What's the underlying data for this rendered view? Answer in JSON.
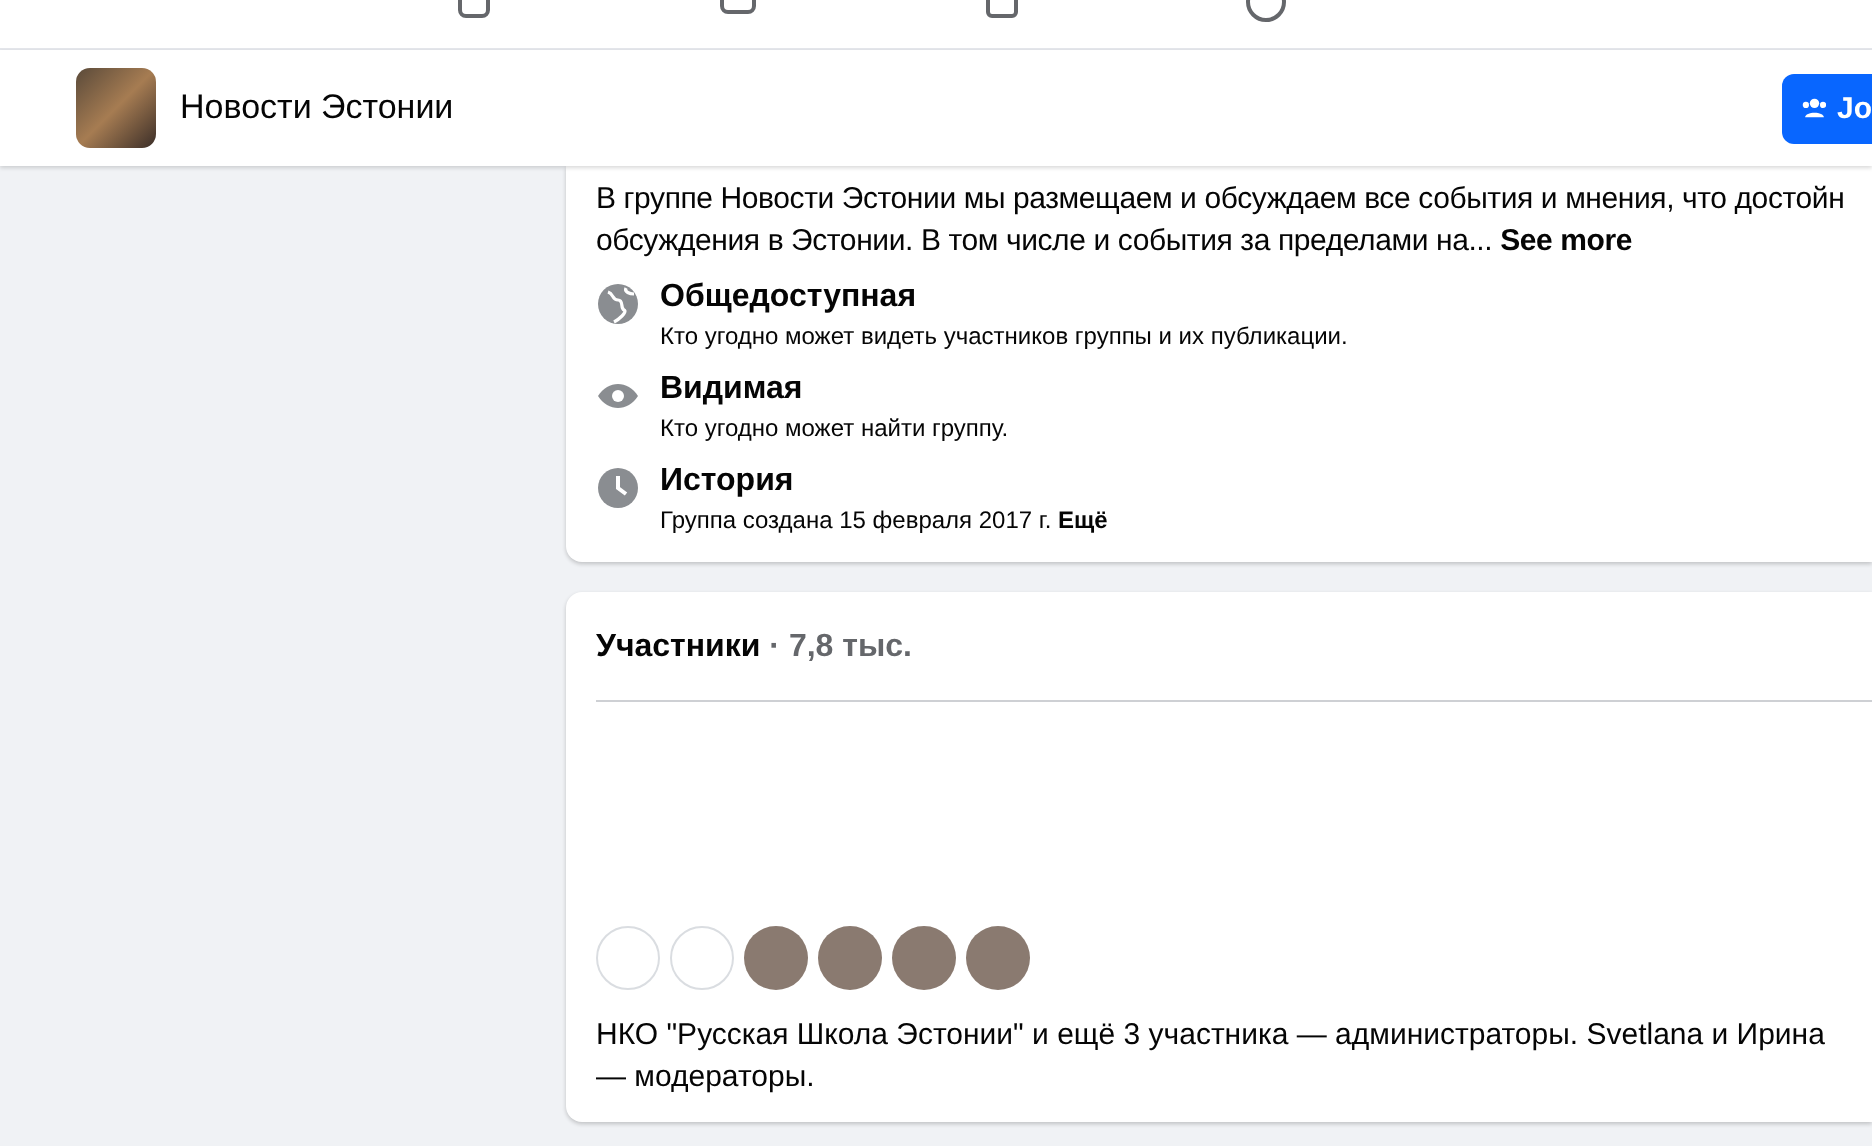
{
  "top_nav": {
    "items": [
      {
        "kind": "grid"
      },
      {
        "kind": "screen"
      },
      {
        "kind": "store"
      },
      {
        "kind": "people"
      }
    ]
  },
  "group_header": {
    "title": "Новости Эстонии",
    "join_button": "Jo"
  },
  "about": {
    "description_lines": [
      "В группе Новости Эстонии мы размещаем и обсуждаем все события и мнения, что достойн",
      "обсуждения в Эстонии. В том числе и события за пределами на..."
    ],
    "see_more": "See more",
    "facts": [
      {
        "kind": "globe",
        "title": "Общедоступная",
        "text": "Кто угодно может видеть участников группы и их публикации."
      },
      {
        "kind": "eye",
        "title": "Видимая",
        "text": "Кто угодно может найти группу."
      },
      {
        "kind": "clock",
        "title": "История",
        "text": "Группа создана 15 февраля 2017 г. **Ещё**"
      }
    ]
  },
  "members": {
    "title": "Участники",
    "count": "· 7,8 тыс.",
    "avatars": [
      {
        "kind": "logo"
      },
      {
        "kind": "logo"
      },
      {
        "kind": "photo"
      },
      {
        "kind": "photo"
      },
      {
        "kind": "photo"
      },
      {
        "kind": "photo"
      }
    ],
    "summary": "НКО \"Русская Школа Эстонии\" и ещё 3 участника — администраторы. Svetlana и Ирина — модераторы."
  }
}
